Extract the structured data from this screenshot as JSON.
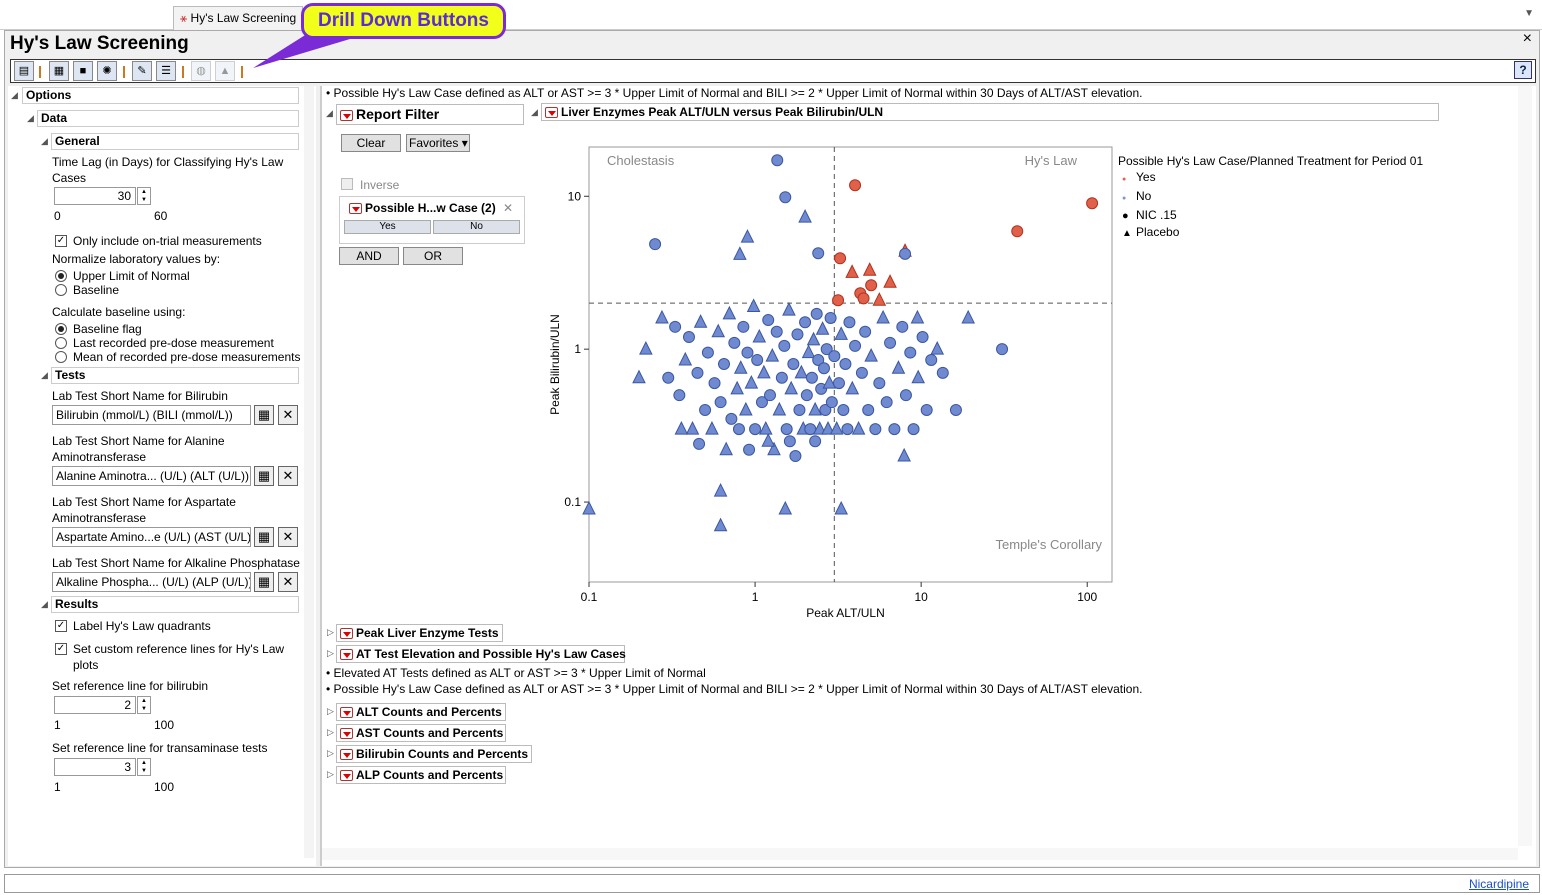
{
  "tab": {
    "label": "Hy's Law Screening"
  },
  "window": {
    "title": "Hy's Law Screening",
    "close": "×",
    "dropdown": "▼"
  },
  "callout": {
    "text": "Drill Down Buttons"
  },
  "toolbar": {
    "help": "?"
  },
  "options": {
    "header": "Options",
    "data": "Data",
    "general": "General",
    "time_lag_label": "Time Lag (in Days) for Classifying Hy's Law Cases",
    "time_lag_value": "30",
    "time_lag_min": "0",
    "time_lag_max": "60",
    "only_on_trial": "Only include on-trial measurements",
    "normalize_label": "Normalize laboratory values by:",
    "normalize_opts": [
      "Upper Limit of Normal",
      "Baseline"
    ],
    "baseline_label": "Calculate baseline using:",
    "baseline_opts": [
      "Baseline flag",
      "Last recorded pre-dose measurement",
      "Mean of recorded pre-dose measurements"
    ],
    "tests": "Tests",
    "bili_label": "Lab Test Short Name for Bilirubin",
    "bili_value": "Bilirubin (mmol/L) (BILI (mmol/L))",
    "alt_label": "Lab Test Short Name for Alanine Aminotransferase",
    "alt_value": "Alanine Aminotra... (U/L) (ALT (U/L))",
    "ast_label": "Lab Test Short Name for Aspartate Aminotransferase",
    "ast_value": "Aspartate Amino...e (U/L) (AST (U/L))",
    "alp_label": "Lab Test Short Name for Alkaline Phosphatase",
    "alp_value": "Alkaline Phospha... (U/L) (ALP (U/L))",
    "results": "Results",
    "label_quadrants": "Label Hy's Law quadrants",
    "custom_ref": "Set custom reference lines for Hy's Law plots",
    "bili_ref_label": "Set reference line for bilirubin",
    "bili_ref_value": "2",
    "bili_ref_min": "1",
    "bili_ref_max": "100",
    "trans_ref_label": "Set reference line for transaminase tests",
    "trans_ref_value": "3",
    "trans_ref_min": "1",
    "trans_ref_max": "100"
  },
  "main": {
    "note_top": "Possible Hy's Law Case defined as ALT or AST >= 3 * Upper Limit of Normal and BILI >= 2 * Upper Limit of Normal within 30 Days of ALT/AST elevation.",
    "filter": {
      "title": "Report Filter",
      "clear": "Clear",
      "favorites": "Favorites",
      "inverse": "Inverse",
      "group": "Possible H...w Case (2)",
      "yes": "Yes",
      "no": "No",
      "and": "AND",
      "or": "OR"
    },
    "plot_title": "Liver Enzymes Peak ALT/ULN versus Peak Bilirubin/ULN",
    "sections": [
      "Peak Liver Enzyme Tests",
      "AT Test Elevation and Possible Hy's Law Cases"
    ],
    "notes": [
      "Elevated AT Tests defined as ALT or AST >= 3 * Upper Limit of Normal",
      "Possible Hy's Law Case defined as ALT or AST >= 3 * Upper Limit of Normal and BILI >= 2 * Upper Limit of Normal within 30 Days of ALT/AST elevation."
    ],
    "count_sections": [
      "ALT Counts and Percents",
      "AST Counts and Percents",
      "Bilirubin Counts and Percents",
      "ALP Counts and Percents"
    ]
  },
  "status": {
    "link": "Nicardipine"
  },
  "chart_data": {
    "type": "scatter",
    "title": "Liver Enzymes Peak ALT/ULN versus Peak Bilirubin/ULN",
    "xlabel": "Peak ALT/ULN",
    "ylabel": "Peak Bilirubin/ULN",
    "xscale": "log",
    "yscale": "log",
    "xlim": [
      0.1,
      141
    ],
    "ylim": [
      0.03,
      21
    ],
    "xticks": [
      "0.1",
      "1",
      "10",
      "100"
    ],
    "yticks": [
      "0.1",
      "1",
      "10"
    ],
    "ref_lines": {
      "x": 3,
      "y": 2
    },
    "quadrant_labels": [
      "Cholestasis",
      "Hy's Law",
      "Temple's Corollary"
    ],
    "legend": {
      "title": "Possible Hy's Law Case/Planned Treatment for Period 01",
      "items": [
        {
          "label": "Yes",
          "color": "#e06650",
          "marker": "dot"
        },
        {
          "label": "No",
          "color": "#7f95d1",
          "marker": "dot"
        },
        {
          "label": "NIC .15",
          "color": "#000000",
          "marker": "circle"
        },
        {
          "label": "Placebo",
          "color": "#000000",
          "marker": "triangle"
        }
      ]
    },
    "colors": {
      "Yes": "#e0604a",
      "No": "#6f8ad0"
    },
    "points": [
      [
        4.0,
        11.8,
        "Yes",
        "c"
      ],
      [
        107,
        9.0,
        "Yes",
        "c"
      ],
      [
        37.9,
        5.9,
        "Yes",
        "c"
      ],
      [
        3.25,
        3.93,
        "Yes",
        "c"
      ],
      [
        5.0,
        2.62,
        "Yes",
        "c"
      ],
      [
        4.3,
        2.32,
        "Yes",
        "c"
      ],
      [
        4.5,
        2.15,
        "Yes",
        "c"
      ],
      [
        3.16,
        2.09,
        "Yes",
        "c"
      ],
      [
        3.84,
        3.18,
        "Yes",
        "t"
      ],
      [
        4.9,
        3.28,
        "Yes",
        "t"
      ],
      [
        6.5,
        2.74,
        "Yes",
        "t"
      ],
      [
        8.0,
        4.37,
        "Yes",
        "t"
      ],
      [
        5.6,
        2.09,
        "Yes",
        "t"
      ],
      [
        1.36,
        17.2,
        "No",
        "c"
      ],
      [
        1.52,
        9.86,
        "No",
        "c"
      ],
      [
        2.0,
        7.3,
        "No",
        "t"
      ],
      [
        0.25,
        4.86,
        "No",
        "c"
      ],
      [
        0.9,
        5.4,
        "No",
        "t"
      ],
      [
        0.81,
        4.17,
        "No",
        "t"
      ],
      [
        2.4,
        4.24,
        "No",
        "c"
      ],
      [
        8.0,
        4.2,
        "No",
        "c"
      ],
      [
        30.7,
        1.0,
        "No",
        "c"
      ],
      [
        19.2,
        1.6,
        "No",
        "t"
      ],
      [
        16.2,
        0.4,
        "No",
        "c"
      ],
      [
        0.2,
        0.65,
        "No",
        "t"
      ],
      [
        0.62,
        0.118,
        "No",
        "t"
      ],
      [
        0.62,
        0.07,
        "No",
        "t"
      ],
      [
        1.52,
        0.09,
        "No",
        "t"
      ],
      [
        3.3,
        0.09,
        "No",
        "t"
      ],
      [
        0.1,
        0.09,
        "No",
        "t"
      ],
      [
        7.9,
        0.2,
        "No",
        "t"
      ],
      [
        0.275,
        1.6,
        "No",
        "t"
      ],
      [
        0.22,
        1.0,
        "No",
        "t"
      ],
      [
        0.3,
        0.65,
        "No",
        "c"
      ],
      [
        0.33,
        1.4,
        "No",
        "c"
      ],
      [
        0.35,
        0.5,
        "No",
        "c"
      ],
      [
        0.38,
        0.85,
        "No",
        "t"
      ],
      [
        0.4,
        1.2,
        "No",
        "c"
      ],
      [
        0.42,
        0.3,
        "No",
        "t"
      ],
      [
        0.45,
        0.7,
        "No",
        "c"
      ],
      [
        0.47,
        1.5,
        "No",
        "t"
      ],
      [
        0.5,
        0.4,
        "No",
        "c"
      ],
      [
        0.52,
        0.95,
        "No",
        "c"
      ],
      [
        0.55,
        0.3,
        "No",
        "t"
      ],
      [
        0.57,
        0.6,
        "No",
        "c"
      ],
      [
        0.6,
        1.3,
        "No",
        "t"
      ],
      [
        0.62,
        0.45,
        "No",
        "c"
      ],
      [
        0.65,
        0.8,
        "No",
        "c"
      ],
      [
        0.67,
        0.22,
        "No",
        "t"
      ],
      [
        0.7,
        1.7,
        "No",
        "t"
      ],
      [
        0.72,
        0.35,
        "No",
        "c"
      ],
      [
        0.75,
        1.1,
        "No",
        "c"
      ],
      [
        0.78,
        0.55,
        "No",
        "t"
      ],
      [
        0.8,
        0.3,
        "No",
        "c"
      ],
      [
        0.82,
        0.75,
        "No",
        "t"
      ],
      [
        0.85,
        1.4,
        "No",
        "c"
      ],
      [
        0.88,
        0.4,
        "No",
        "t"
      ],
      [
        0.9,
        0.95,
        "No",
        "c"
      ],
      [
        0.92,
        0.22,
        "No",
        "c"
      ],
      [
        0.95,
        0.6,
        "No",
        "t"
      ],
      [
        0.98,
        1.9,
        "No",
        "t"
      ],
      [
        1.0,
        0.3,
        "No",
        "c"
      ],
      [
        1.03,
        0.85,
        "No",
        "c"
      ],
      [
        1.06,
        1.2,
        "No",
        "t"
      ],
      [
        1.1,
        0.45,
        "No",
        "c"
      ],
      [
        1.13,
        0.7,
        "No",
        "t"
      ],
      [
        1.16,
        0.3,
        "No",
        "t"
      ],
      [
        1.2,
        1.55,
        "No",
        "c"
      ],
      [
        1.23,
        0.5,
        "No",
        "c"
      ],
      [
        1.27,
        0.9,
        "No",
        "t"
      ],
      [
        1.3,
        0.22,
        "No",
        "t"
      ],
      [
        1.35,
        1.3,
        "No",
        "c"
      ],
      [
        1.4,
        0.4,
        "No",
        "t"
      ],
      [
        1.45,
        0.65,
        "No",
        "c"
      ],
      [
        1.5,
        1.05,
        "No",
        "c"
      ],
      [
        1.55,
        0.3,
        "No",
        "c"
      ],
      [
        1.6,
        1.8,
        "No",
        "t"
      ],
      [
        1.65,
        0.55,
        "No",
        "t"
      ],
      [
        1.7,
        0.8,
        "No",
        "c"
      ],
      [
        1.75,
        0.2,
        "No",
        "c"
      ],
      [
        1.8,
        1.25,
        "No",
        "c"
      ],
      [
        1.85,
        0.4,
        "No",
        "c"
      ],
      [
        1.9,
        0.7,
        "No",
        "t"
      ],
      [
        1.95,
        0.3,
        "No",
        "t"
      ],
      [
        2.0,
        1.5,
        "No",
        "c"
      ],
      [
        2.05,
        0.5,
        "No",
        "c"
      ],
      [
        2.1,
        0.95,
        "No",
        "t"
      ],
      [
        2.15,
        0.3,
        "No",
        "c"
      ],
      [
        2.2,
        0.65,
        "No",
        "c"
      ],
      [
        2.25,
        1.15,
        "No",
        "t"
      ],
      [
        2.3,
        0.4,
        "No",
        "t"
      ],
      [
        2.35,
        1.7,
        "No",
        "c"
      ],
      [
        2.4,
        0.85,
        "No",
        "c"
      ],
      [
        2.45,
        0.3,
        "No",
        "t"
      ],
      [
        2.5,
        0.55,
        "No",
        "c"
      ],
      [
        2.55,
        1.35,
        "No",
        "t"
      ],
      [
        2.6,
        0.75,
        "No",
        "c"
      ],
      [
        2.65,
        0.4,
        "No",
        "c"
      ],
      [
        2.7,
        1.0,
        "No",
        "c"
      ],
      [
        2.75,
        0.3,
        "No",
        "t"
      ],
      [
        2.8,
        0.6,
        "No",
        "t"
      ],
      [
        2.85,
        1.6,
        "No",
        "c"
      ],
      [
        2.9,
        0.45,
        "No",
        "c"
      ],
      [
        3.0,
        0.9,
        "No",
        "c"
      ],
      [
        3.1,
        0.3,
        "No",
        "t"
      ],
      [
        3.2,
        0.6,
        "No",
        "c"
      ],
      [
        3.3,
        1.25,
        "No",
        "t"
      ],
      [
        3.4,
        0.4,
        "No",
        "c"
      ],
      [
        3.5,
        0.8,
        "No",
        "c"
      ],
      [
        3.6,
        0.3,
        "No",
        "c"
      ],
      [
        3.7,
        1.5,
        "No",
        "c"
      ],
      [
        3.85,
        0.55,
        "No",
        "t"
      ],
      [
        4.0,
        1.05,
        "No",
        "c"
      ],
      [
        4.2,
        0.3,
        "No",
        "t"
      ],
      [
        4.4,
        0.7,
        "No",
        "c"
      ],
      [
        4.6,
        1.3,
        "No",
        "c"
      ],
      [
        4.8,
        0.4,
        "No",
        "c"
      ],
      [
        5.0,
        0.9,
        "No",
        "t"
      ],
      [
        5.3,
        0.3,
        "No",
        "c"
      ],
      [
        5.6,
        0.6,
        "No",
        "c"
      ],
      [
        5.9,
        1.6,
        "No",
        "t"
      ],
      [
        6.2,
        0.45,
        "No",
        "c"
      ],
      [
        6.5,
        1.1,
        "No",
        "c"
      ],
      [
        6.9,
        0.3,
        "No",
        "c"
      ],
      [
        7.3,
        0.75,
        "No",
        "t"
      ],
      [
        7.7,
        1.4,
        "No",
        "c"
      ],
      [
        8.1,
        0.5,
        "No",
        "c"
      ],
      [
        8.6,
        0.95,
        "No",
        "c"
      ],
      [
        9.0,
        0.3,
        "No",
        "c"
      ],
      [
        9.6,
        0.65,
        "No",
        "t"
      ],
      [
        10.2,
        1.2,
        "No",
        "c"
      ],
      [
        10.8,
        0.4,
        "No",
        "c"
      ],
      [
        11.5,
        0.85,
        "No",
        "c"
      ],
      [
        12.5,
        1.0,
        "No",
        "t"
      ],
      [
        13.5,
        0.7,
        "No",
        "c"
      ],
      [
        9.5,
        1.6,
        "No",
        "t"
      ],
      [
        0.36,
        0.3,
        "No",
        "t"
      ],
      [
        0.46,
        0.24,
        "No",
        "c"
      ],
      [
        1.62,
        0.25,
        "No",
        "c"
      ],
      [
        2.3,
        0.25,
        "No",
        "c"
      ],
      [
        1.2,
        0.25,
        "No",
        "t"
      ]
    ]
  }
}
